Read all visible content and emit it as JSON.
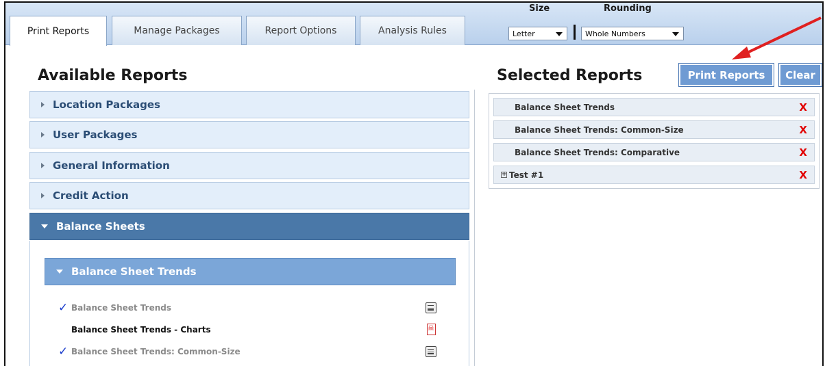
{
  "tabs": [
    {
      "label": "Print Reports",
      "active": true
    },
    {
      "label": "Manage Packages",
      "active": false
    },
    {
      "label": "Report Options",
      "active": false
    },
    {
      "label": "Analysis Rules",
      "active": false
    }
  ],
  "size": {
    "label": "Size",
    "value": "Letter"
  },
  "rounding": {
    "label": "Rounding",
    "value": "Whole Numbers"
  },
  "available": {
    "title": "Available Reports",
    "sections": [
      {
        "label": "Location Packages"
      },
      {
        "label": "User Packages"
      },
      {
        "label": "General Information"
      },
      {
        "label": "Credit Action"
      },
      {
        "label": "Balance Sheets"
      }
    ],
    "subsection": "Balance Sheet Trends",
    "reports": [
      {
        "name": "Balance Sheet Trends",
        "checked": true,
        "icon": "print-icon"
      },
      {
        "name": "Balance Sheet Trends - Charts",
        "checked": false,
        "icon": "pdf-icon"
      },
      {
        "name": "Balance Sheet Trends: Common-Size",
        "checked": true,
        "icon": "print-icon"
      }
    ]
  },
  "selected": {
    "title": "Selected Reports",
    "print_label": "Print Reports",
    "clear_label": "Clear",
    "remove_symbol": "X",
    "plus_symbol": "+",
    "items": [
      {
        "label": "Balance Sheet Trends"
      },
      {
        "label": "Balance Sheet Trends: Common-Size"
      },
      {
        "label": "Balance Sheet Trends: Comparative"
      },
      {
        "label": "Test #1"
      }
    ]
  },
  "colors": {
    "accent": "#4a78a8",
    "button": "#6f9bd3",
    "remove": "#e10000",
    "arrow": "#e02020"
  }
}
